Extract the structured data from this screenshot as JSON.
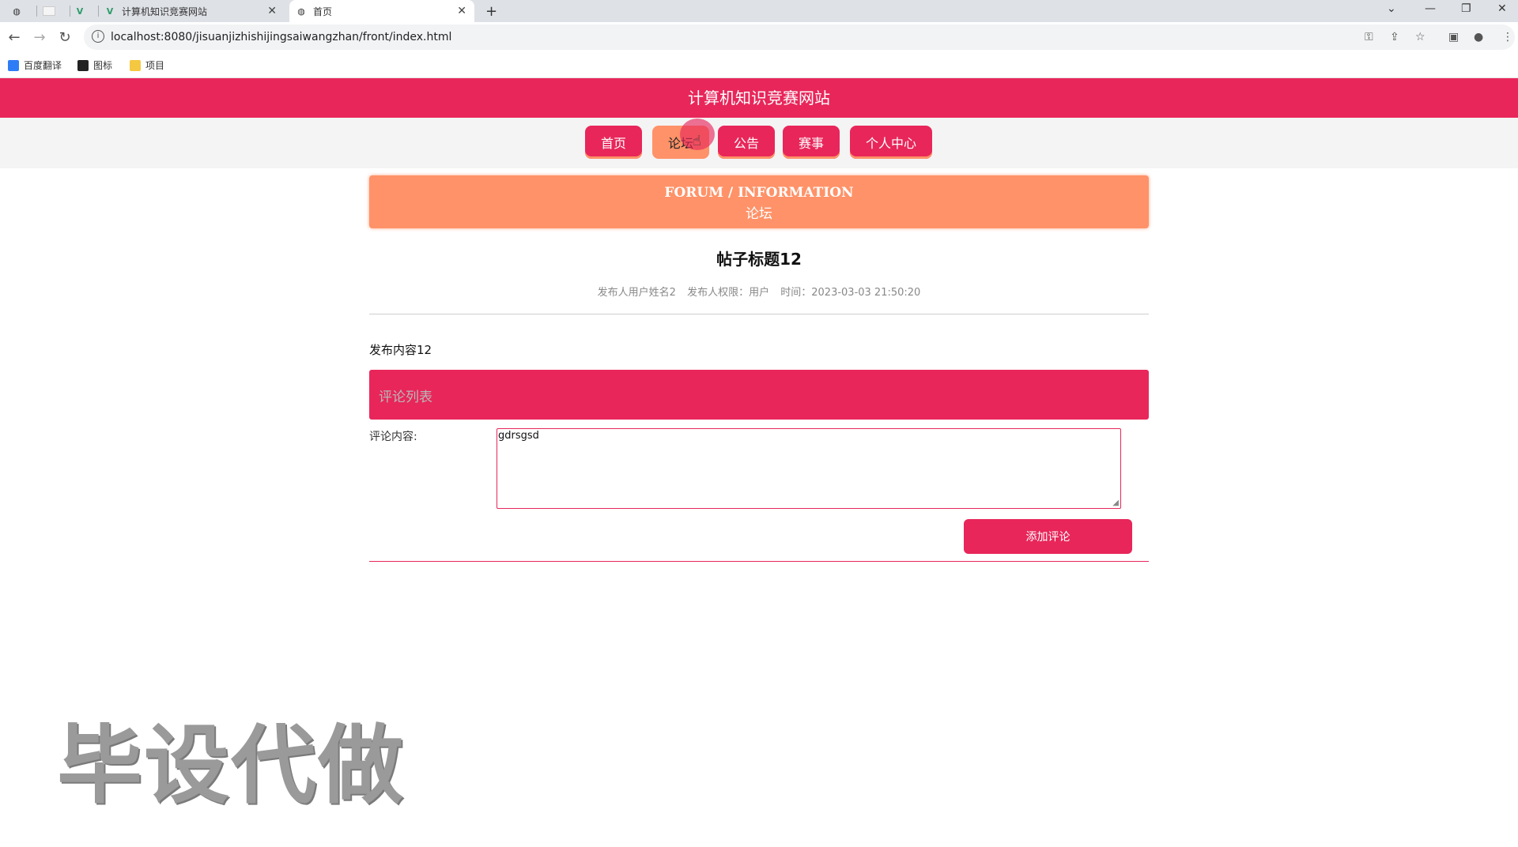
{
  "browser": {
    "tabs": [
      {
        "title": "",
        "icon": "globe-icon"
      },
      {
        "title": "",
        "icon": "blank-page-icon"
      },
      {
        "title": "",
        "icon": "vue-icon"
      },
      {
        "title": "计算机知识竞赛网站",
        "icon": "vue-icon"
      },
      {
        "title": "首页",
        "icon": "globe-icon",
        "active": true
      }
    ],
    "url": "localhost:8080/jisuanjizhishijingsaiwangzhan/front/index.html",
    "bookmarks": [
      {
        "label": "百度翻译",
        "icon": "baidu-translate-icon"
      },
      {
        "label": "图标",
        "icon": "image-icon"
      },
      {
        "label": "项目",
        "icon": "folder-icon"
      }
    ]
  },
  "site": {
    "title": "计算机知识竞赛网站",
    "nav": [
      {
        "label": "首页"
      },
      {
        "label": "论坛",
        "active": true
      },
      {
        "label": "公告"
      },
      {
        "label": "赛事"
      },
      {
        "label": "个人中心"
      }
    ]
  },
  "banner": {
    "en": "FORUM / INFORMATION",
    "cn": "论坛"
  },
  "post": {
    "title": "帖子标题12",
    "author": "发布人用户姓名2",
    "role": "发布人权限：用户",
    "time": "时间：2023-03-03 21:50:20",
    "content": "发布内容12"
  },
  "comments": {
    "header": "评论列表",
    "input_label": "评论内容:",
    "input_value": "gdrsgsd",
    "submit_label": "添加评论"
  },
  "watermark": "毕设代做",
  "colors": {
    "primary": "#e8265a",
    "accent": "#ff9268"
  }
}
